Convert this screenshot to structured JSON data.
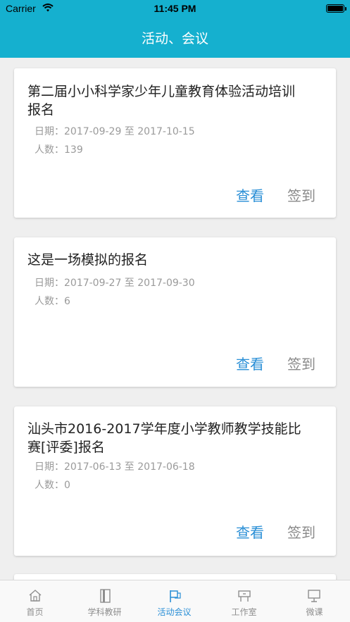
{
  "status_bar": {
    "carrier": "Carrier",
    "time": "11:45 PM"
  },
  "header": {
    "title": "活动、会议"
  },
  "activities": [
    {
      "title_line1": "第二届小小科学家少年儿童教育体验活动培训",
      "title_line2": "报名",
      "date": "日期：2017-09-29 至 2017-10-15",
      "count": "人数：139",
      "view_label": "查看",
      "signin_label": "签到"
    },
    {
      "title_line1": "这是一场模拟的报名",
      "title_line2": "",
      "date": "日期：2017-09-27 至 2017-09-30",
      "count": "人数：6",
      "view_label": "查看",
      "signin_label": "签到"
    },
    {
      "title_line1": "汕头市2016-2017学年度小学教师教学技能比",
      "title_line2": "赛[评委]报名",
      "date": "日期：2017-06-13 至 2017-06-18",
      "count": "人数：0",
      "view_label": "查看",
      "signin_label": "签到"
    }
  ],
  "tabbar": {
    "items": [
      {
        "label": "首页",
        "icon": "home-icon"
      },
      {
        "label": "学科教研",
        "icon": "book-icon"
      },
      {
        "label": "活动会议",
        "icon": "flag-icon",
        "active": true
      },
      {
        "label": "工作室",
        "icon": "studio-icon"
      },
      {
        "label": "微课",
        "icon": "screen-icon"
      }
    ]
  },
  "colors": {
    "header": "#15b0cf",
    "accent": "#2a8fd6",
    "muted": "#8e8e8e"
  }
}
